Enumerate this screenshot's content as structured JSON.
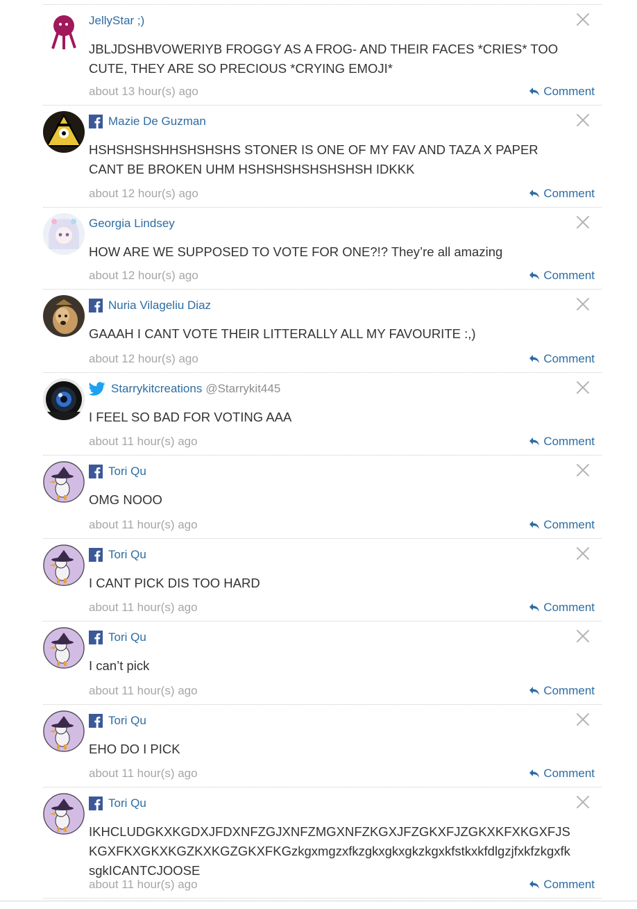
{
  "comments": [
    {
      "author": "JellyStar ;)",
      "handle": "",
      "source": "none",
      "avatar": "pink-character-avatar",
      "text": "JBLJDSHBVOWERIYB FROGGY AS A FROG- AND THEIR FACES *CRIES* TOO CUTE, THEY ARE SO PRECIOUS *CRYING EMOJI*",
      "time": "about 13 hour(s) ago",
      "reply_label": "Comment"
    },
    {
      "author": "Mazie De Guzman",
      "handle": "",
      "source": "facebook",
      "avatar": "triangle-character-avatar",
      "text": "HSHSHSHSHHSHSHSHS STONER IS ONE OF MY FAV AND TAZA X PAPER CANT BE BROKEN UHM HSHSHSHSHSHSHSH IDKKK",
      "time": "about 12 hour(s) ago",
      "reply_label": "Comment"
    },
    {
      "author": "Georgia Lindsey",
      "handle": "",
      "source": "none",
      "avatar": "anime-girl-avatar",
      "text": "HOW ARE WE SUPPOSED TO VOTE FOR ONE?!? They’re all amazing",
      "time": "about 12 hour(s) ago",
      "reply_label": "Comment"
    },
    {
      "author": "Nuria Vilageliu Diaz",
      "handle": "",
      "source": "facebook",
      "avatar": "dog-photo-avatar",
      "text": "GAAAH I CANT VOTE THEIR LITTERALLY ALL MY FAVOURITE :,)",
      "time": "about 12 hour(s) ago",
      "reply_label": "Comment"
    },
    {
      "author": "Starrykitcreations",
      "handle": "@Starrykit445",
      "source": "twitter",
      "avatar": "camera-lens-avatar",
      "text": "I FEEL SO BAD FOR VOTING AAA",
      "time": "about 11 hour(s) ago",
      "reply_label": "Comment"
    },
    {
      "author": "Tori Qu",
      "handle": "",
      "source": "facebook",
      "avatar": "witch-duck-avatar",
      "text": "OMG NOOO",
      "time": "about 11 hour(s) ago",
      "reply_label": "Comment"
    },
    {
      "author": "Tori Qu",
      "handle": "",
      "source": "facebook",
      "avatar": "witch-duck-avatar",
      "text": "I CANT PICK DIS TOO HARD",
      "time": "about 11 hour(s) ago",
      "reply_label": "Comment"
    },
    {
      "author": "Tori Qu",
      "handle": "",
      "source": "facebook",
      "avatar": "witch-duck-avatar",
      "text": "I can’t pick",
      "time": "about 11 hour(s) ago",
      "reply_label": "Comment"
    },
    {
      "author": "Tori Qu",
      "handle": "",
      "source": "facebook",
      "avatar": "witch-duck-avatar",
      "text": "EHO DO I PICK",
      "time": "about 11 hour(s) ago",
      "reply_label": "Comment"
    },
    {
      "author": "Tori Qu",
      "handle": "",
      "source": "facebook",
      "avatar": "witch-duck-avatar",
      "text": "IKHCLUDGKXKGDXJFDXNFZGJXNFZMGXNFZKGXJFZGKXFJZGKXKFXKGXFJSKGXFKXGKXKGZKXKGZGKXFKGzkgxmgzxfkzgkxgkxgkzkgxkfstkxkfdlgzjfxkfzkgxfksgkICANTCJOOSE",
      "time": "about 11 hour(s) ago",
      "reply_label": "Comment"
    }
  ],
  "colors": {
    "link": "#2d6ca2",
    "meta": "#a6a6a6",
    "facebook": "#3b5998",
    "twitter": "#1da1f2"
  }
}
